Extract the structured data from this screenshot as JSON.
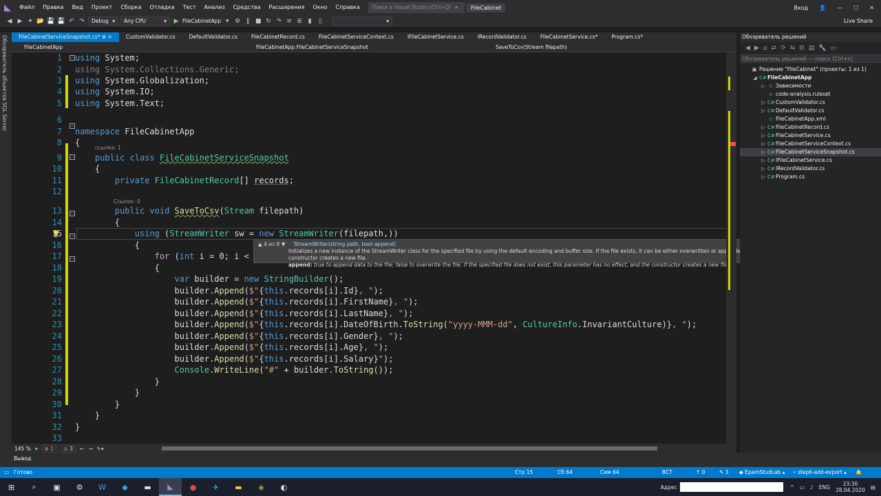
{
  "menubar": {
    "items": [
      "Файл",
      "Правка",
      "Вид",
      "Проект",
      "Сборка",
      "Отладка",
      "Тест",
      "Анализ",
      "Средства",
      "Расширения",
      "Окно",
      "Справка"
    ],
    "search_placeholder": "Поиск в Visual Studio (Ctrl+Q)",
    "title": "FileCabinet",
    "signin": "Вход"
  },
  "toolbar": {
    "config": "Debug",
    "platform": "Any CPU",
    "start": "FileCabinetApp",
    "live_share": "Live Share"
  },
  "left_strip": {
    "label": "Обозреватель объектов SQL Server"
  },
  "tabs": [
    {
      "label": "FileCabinetServiceSnapshot.cs* ⊕ ×",
      "active": true
    },
    {
      "label": "CustomValidator.cs"
    },
    {
      "label": "DefaultValidator.cs"
    },
    {
      "label": "FileCabinetRecord.cs"
    },
    {
      "label": "FileCabinetServiceContext.cs"
    },
    {
      "label": "IFileCabinetService.cs"
    },
    {
      "label": "IRecordValidator.cs"
    },
    {
      "label": "FileCabinetService.cs*"
    },
    {
      "label": "Program.cs*"
    }
  ],
  "navbar": {
    "project": "FileCabinetApp",
    "class": "FileCabinetApp.FileCabinetServiceSnapshot",
    "member": "SaveToCsv(Stream filepath)"
  },
  "editor": {
    "codelens_class": "ссылка: 1",
    "codelens_method": "Ссылок: 0",
    "line_numbers": [
      "1",
      "2",
      "3",
      "4",
      "5",
      "6",
      "7",
      "8",
      "9",
      "10",
      "11",
      "12",
      "13",
      "14",
      "15",
      "16",
      "17",
      "18",
      "19",
      "20",
      "21",
      "22",
      "23",
      "24",
      "25",
      "26",
      "27",
      "28",
      "29",
      "30",
      "31",
      "32",
      "33"
    ],
    "current_line": "15"
  },
  "tooltip": {
    "counter": "▲ 4 из 8 ▼",
    "signature": "StreamWriter(string path, bool append)",
    "description": "Initializes a new instance of the StreamWriter class for the specified file by using the default encoding and buffer size. If the file exists, it can be either overwritten or appended to. If the file does not exist, this constructor creates a new file.",
    "param_name": "append:",
    "param_desc": "true to append data to the file; false to overwrite the file. If the specified file does not exist, this parameter has no effect, and the constructor creates a new file."
  },
  "bottom_bar": {
    "zoom": "145 %",
    "errors": "1",
    "warnings": "3"
  },
  "solution_explorer": {
    "title": "Обозреватель решений",
    "search_placeholder": "Обозреватель решений — поиск (Ctrl+к)",
    "items": [
      {
        "label": "Решение \"FileCabinet\" (проекты: 1 из 1)",
        "level": 0,
        "arrow": ""
      },
      {
        "label": "FileCabinetApp",
        "level": 1,
        "arrow": "◢",
        "bold": true
      },
      {
        "label": "Зависимости",
        "level": 2,
        "arrow": "▷"
      },
      {
        "label": "code-analysis.ruleset",
        "level": 2,
        "arrow": ""
      },
      {
        "label": "CustomValidator.cs",
        "level": 2,
        "arrow": "▷"
      },
      {
        "label": "DefaultValidator.cs",
        "level": 2,
        "arrow": "▷"
      },
      {
        "label": "FileCabinetApp.xml",
        "level": 2,
        "arrow": ""
      },
      {
        "label": "FileCabinetRecord.cs",
        "level": 2,
        "arrow": "▷"
      },
      {
        "label": "FileCabinetService.cs",
        "level": 2,
        "arrow": "▷"
      },
      {
        "label": "FileCabinetServiceContext.cs",
        "level": 2,
        "arrow": "▷"
      },
      {
        "label": "FileCabinetServiceSnapshot.cs",
        "level": 2,
        "arrow": "▷",
        "selected": true
      },
      {
        "label": "IFileCabinetService.cs",
        "level": 2,
        "arrow": "▷"
      },
      {
        "label": "IRecordValidator.cs",
        "level": 2,
        "arrow": "▷"
      },
      {
        "label": "Program.cs",
        "level": 2,
        "arrow": "▷"
      }
    ]
  },
  "output_panel": {
    "label": "Вывод"
  },
  "statusbar": {
    "ready": "Готово",
    "line": "Стр 15",
    "col": "Сб 64",
    "ch": "Сим 64",
    "mode": "ВСТ",
    "up": "↑ 0",
    "pencil": "✎ 3",
    "repo": "EpamStudLab",
    "branch": "step6-add-export"
  },
  "taskbar": {
    "address_label": "Адрес",
    "lang": "ENG",
    "time": "23:30",
    "date": "28.04.2020"
  },
  "colors": {
    "accent": "#007acc",
    "editor_bg": "#1e1e1e",
    "chrome": "#2d2d30"
  }
}
